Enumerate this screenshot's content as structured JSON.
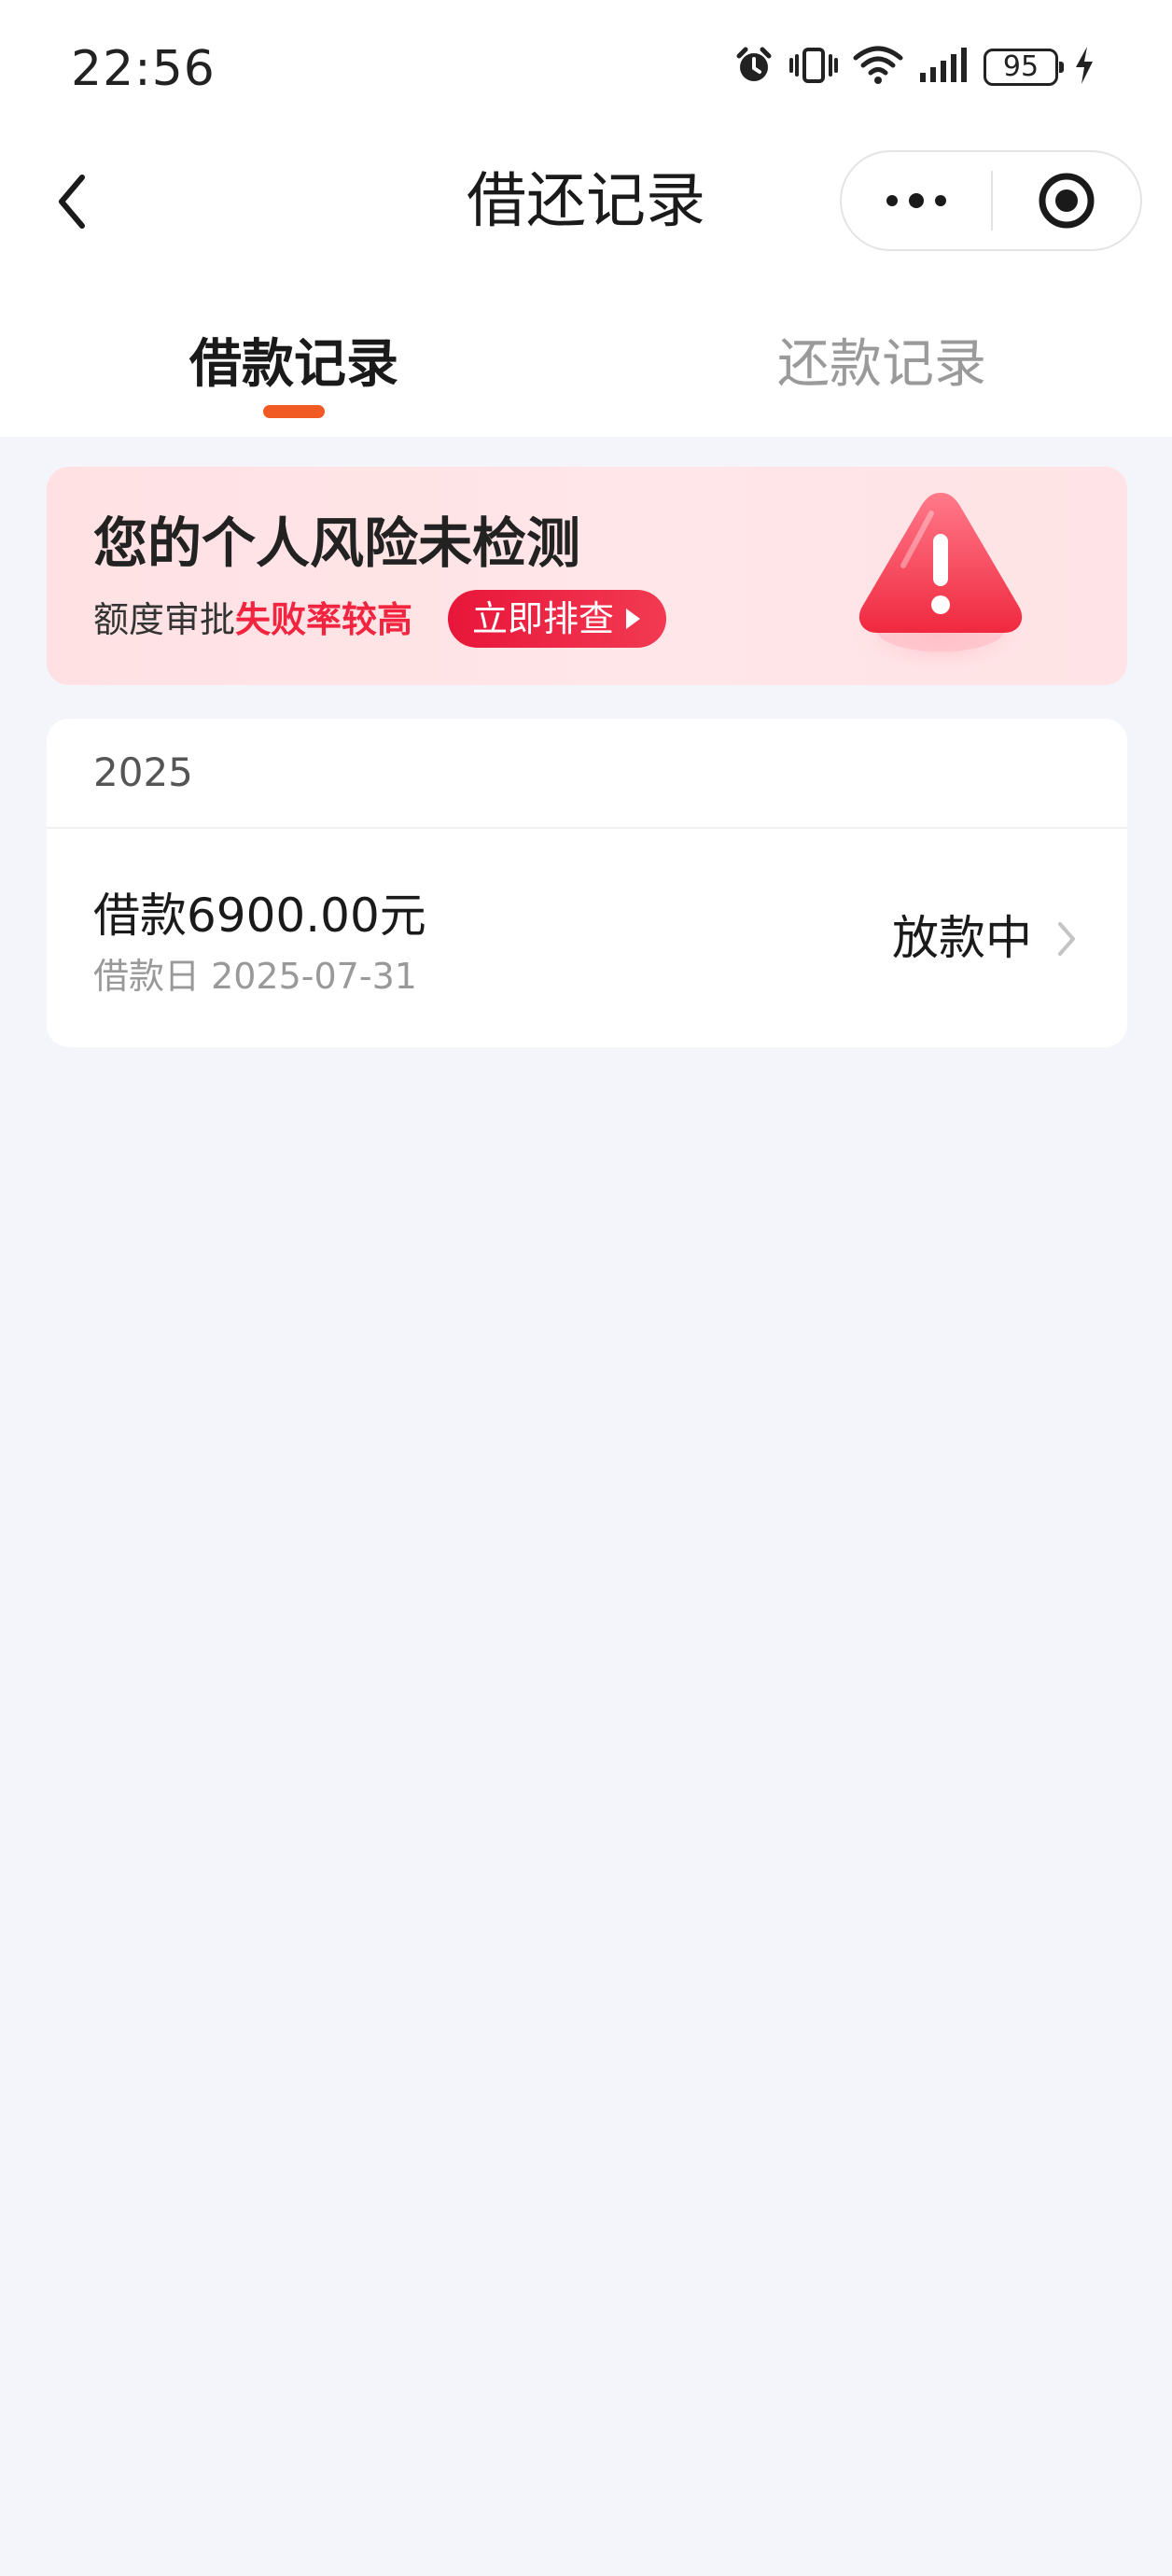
{
  "status_bar": {
    "time": "22:56",
    "battery": "95",
    "icons": [
      "alarm-icon",
      "vibrate-icon",
      "wifi-icon",
      "signal-icon",
      "battery-icon",
      "charging-icon"
    ]
  },
  "nav": {
    "title": "借还记录",
    "back_icon": "chevron-left-icon",
    "more_icon": "more-dots-icon",
    "close_icon": "target-close-icon"
  },
  "tabs": [
    {
      "label": "借款记录",
      "active": true
    },
    {
      "label": "还款记录",
      "active": false
    }
  ],
  "risk_banner": {
    "title": "您的个人风险未检测",
    "desc_prefix": "额度审批",
    "desc_highlight": "失败率较高",
    "button_label": "立即排查",
    "icon": "warning-triangle-icon"
  },
  "records": {
    "year": "2025",
    "items": [
      {
        "amount": "借款6900.00元",
        "date": "借款日 2025-07-31",
        "status": "放款中"
      }
    ]
  },
  "colors": {
    "accent": "#f25a24",
    "danger": "#f2243f",
    "background": "#f4f5fa"
  }
}
